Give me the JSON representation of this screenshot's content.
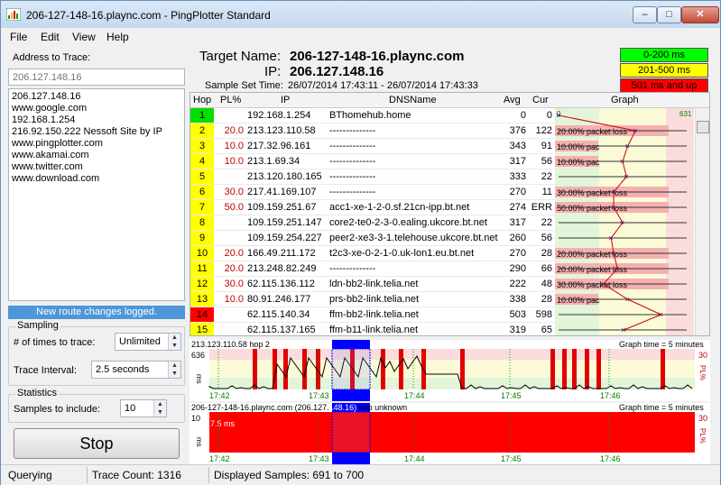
{
  "window": {
    "title": "206-127-148-16.plaync.com - PingPlotter Standard",
    "min": "–",
    "max": "□",
    "close": "✕"
  },
  "menu": [
    "File",
    "Edit",
    "View",
    "Help"
  ],
  "left": {
    "address_label": "Address to Trace:",
    "address_placeholder": "206.127.148.16",
    "history": [
      "206.127.148.16",
      "www.google.com",
      "192.168.1.254",
      "216.92.150.222 Nessoft Site by IP",
      "www.pingplotter.com",
      "www.akamai.com",
      "www.twitter.com",
      "www.download.com"
    ],
    "route_banner": "New route changes logged.",
    "sampling_title": "Sampling",
    "times_label": "# of times to trace:",
    "times_value": "Unlimited",
    "interval_label": "Trace Interval:",
    "interval_value": "2.5 seconds",
    "stats_title": "Statistics",
    "samples_label": "Samples to include:",
    "samples_value": "10",
    "stop_label": "Stop"
  },
  "header": {
    "target_label": "Target Name:",
    "target_value": "206-127-148-16.plaync.com",
    "ip_label": "IP:",
    "ip_value": "206.127.148.16",
    "sst_label": "Sample Set Time:",
    "sst_value": "26/07/2014 17:43:11 - 26/07/2014 17:43:33",
    "legend": [
      {
        "text": "0-200 ms",
        "color": "#00ff00",
        "fg": "#000"
      },
      {
        "text": "201-500 ms",
        "color": "#ffff00",
        "fg": "#000"
      },
      {
        "text": "501 ms and up",
        "color": "#ff0000",
        "fg": "#000"
      }
    ]
  },
  "table": {
    "columns": [
      "Hop",
      "PL%",
      "IP",
      "DNSName",
      "Avg",
      "Cur",
      "Graph"
    ],
    "graph_min": "0",
    "graph_max": "631",
    "rows": [
      {
        "hop": "1",
        "pl": "",
        "ip": "192.168.1.254",
        "dns": "BThomehub.home",
        "avg": "0",
        "cur": "0",
        "color": "#00e000",
        "loss": "",
        "pos": 0.0
      },
      {
        "hop": "2",
        "pl": "20.0",
        "ip": "213.123.110.58",
        "dns": "--------------",
        "avg": "376",
        "cur": "122",
        "color": "#ffff00",
        "loss": "20.00% packet loss",
        "pos": 0.6
      },
      {
        "hop": "3",
        "pl": "10.0",
        "ip": "217.32.96.161",
        "dns": "--------------",
        "avg": "343",
        "cur": "91",
        "color": "#ffff00",
        "loss": "10.00% pac",
        "pos": 0.54
      },
      {
        "hop": "4",
        "pl": "10.0",
        "ip": "213.1.69.34",
        "dns": "--------------",
        "avg": "317",
        "cur": "56",
        "color": "#ffff00",
        "loss": "10.00% pac",
        "pos": 0.5
      },
      {
        "hop": "5",
        "pl": "",
        "ip": "213.120.180.165",
        "dns": "--------------",
        "avg": "333",
        "cur": "22",
        "color": "#ffff00",
        "loss": "",
        "pos": 0.53
      },
      {
        "hop": "6",
        "pl": "30.0",
        "ip": "217.41.169.107",
        "dns": "--------------",
        "avg": "270",
        "cur": "11",
        "color": "#ffff00",
        "loss": "30.00% packet loss",
        "pos": 0.43
      },
      {
        "hop": "7",
        "pl": "50.0",
        "ip": "109.159.251.67",
        "dns": "acc1-xe-1-2-0.sf.21cn-ipp.bt.net",
        "avg": "274",
        "cur": "ERR",
        "color": "#ffff00",
        "loss": "50.00% packet loss",
        "pos": 0.43
      },
      {
        "hop": "8",
        "pl": "",
        "ip": "109.159.251.147",
        "dns": "core2-te0-2-3-0.ealing.ukcore.bt.net",
        "avg": "317",
        "cur": "22",
        "color": "#ffff00",
        "loss": "",
        "pos": 0.5
      },
      {
        "hop": "9",
        "pl": "",
        "ip": "109.159.254.227",
        "dns": "peer2-xe3-3-1.telehouse.ukcore.bt.net",
        "avg": "260",
        "cur": "56",
        "color": "#ffff00",
        "loss": "",
        "pos": 0.41
      },
      {
        "hop": "10",
        "pl": "20.0",
        "ip": "166.49.211.172",
        "dns": "t2c3-xe-0-2-1-0.uk-lon1.eu.bt.net",
        "avg": "270",
        "cur": "28",
        "color": "#ffff00",
        "loss": "20.00% packet loss",
        "pos": 0.43
      },
      {
        "hop": "11",
        "pl": "20.0",
        "ip": "213.248.82.249",
        "dns": "--------------",
        "avg": "290",
        "cur": "66",
        "color": "#ffff00",
        "loss": "20.00% packet loss",
        "pos": 0.46
      },
      {
        "hop": "12",
        "pl": "30.0",
        "ip": "62.115.136.112",
        "dns": "ldn-bb2-link.telia.net",
        "avg": "222",
        "cur": "48",
        "color": "#ffff00",
        "loss": "30.00% packet loss",
        "pos": 0.35
      },
      {
        "hop": "13",
        "pl": "10.0",
        "ip": "80.91.246.177",
        "dns": "prs-bb2-link.telia.net",
        "avg": "338",
        "cur": "28",
        "color": "#ffff00",
        "loss": "10.00% pac",
        "pos": 0.54
      },
      {
        "hop": "14",
        "pl": "",
        "ip": "62.115.140.34",
        "dns": "ffm-bb2-link.telia.net",
        "avg": "503",
        "cur": "598",
        "color": "#ff0000",
        "loss": "",
        "pos": 0.8
      },
      {
        "hop": "15",
        "pl": "",
        "ip": "62.115.137.165",
        "dns": "ffm-b11-link.telia.net",
        "avg": "319",
        "cur": "65",
        "color": "#ffff00",
        "loss": "",
        "pos": 0.51
      }
    ]
  },
  "graph1": {
    "title": "213.123.110.58 hop 2",
    "graph_time": "Graph time = 5 minutes",
    "y_top": "636",
    "y_unit": "ms",
    "pl_top": "30",
    "pl_unit": "PL%",
    "x_labels": [
      "17:42",
      "17:43",
      "17:44",
      "17:45",
      "17:46"
    ]
  },
  "graph2": {
    "title_prefix": "206-127-148-16.plaync.com (206.127.",
    "title_sel": "148.16)",
    "title_suffix": " hop unknown",
    "graph_time": "Graph time = 5 minutes",
    "y_top": "10",
    "y_unit": "ms",
    "y_mark": "7.5 ms",
    "pl_top": "30",
    "pl_unit": "PL%",
    "x_labels": [
      "17:42",
      "17:43",
      "17:44",
      "17:45",
      "17:46"
    ]
  },
  "status": {
    "state": "Querying",
    "trace_count": "Trace Count: 1316",
    "displayed": "Displayed Samples: 691 to 700"
  }
}
